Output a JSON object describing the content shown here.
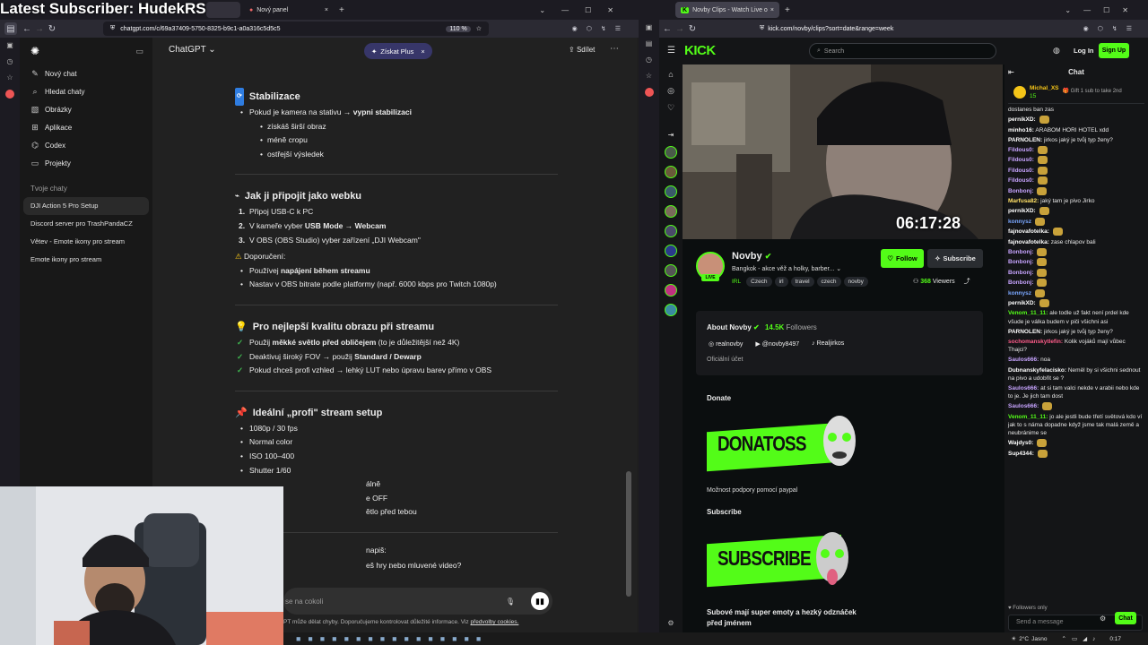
{
  "overlay_title": "Latest Subscriber: HudekRS",
  "left_browser": {
    "tabs": [
      {
        "label": "Nový panel"
      }
    ],
    "url": "chatgpt.com/c/69a37409-5750-8325-b9c1-a0a316c5d5c5",
    "zoom": "110 %"
  },
  "right_browser": {
    "tabs": [
      {
        "label": "Novby Clips - Watch Live o"
      }
    ],
    "url": "kick.com/novby/clips?sort=date&range=week"
  },
  "gpt": {
    "model": "ChatGPT",
    "upgrade": "Získat Plus",
    "share": "Sdílet",
    "sidebar": {
      "items": [
        {
          "label": "Nový chat",
          "icon": "edit-icon"
        },
        {
          "label": "Hledat chaty",
          "icon": "search-icon"
        },
        {
          "label": "Obrázky",
          "icon": "image-icon"
        },
        {
          "label": "Aplikace",
          "icon": "apps-icon"
        },
        {
          "label": "Codex",
          "icon": "code-icon"
        },
        {
          "label": "Projekty",
          "icon": "folder-icon"
        }
      ],
      "section": "Tvoje chaty",
      "chats": [
        "DJI Action 5 Pro Setup",
        "Discord server pro TrashPandaCZ",
        "Větev - Emote ikony pro stream",
        "Emote ikony pro stream"
      ]
    },
    "content": {
      "s1_title": "Stabilizace",
      "s1_b1_pre": "Pokud je kamera na stativu → ",
      "s1_b1_bold": "vypni stabilizaci",
      "s1_sub": [
        "získáš širší obraz",
        "méně cropu",
        "ostřejší výsledek"
      ],
      "s2_title": "Jak ji připojit jako webku",
      "s2_n1": "Připoj USB-C k PC",
      "s2_n2_pre": "V kameře vyber ",
      "s2_n2_bold": "USB Mode → Webcam",
      "s2_n3": "V OBS (OBS Studio) vyber zařízení „DJI Webcam\"",
      "s2_rec": "Doporučení:",
      "s2_r1_pre": "Používej ",
      "s2_r1_bold": "napájení během streamu",
      "s2_r2": "Nastav v OBS bitrate podle platformy (např. 6000 kbps pro Twitch 1080p)",
      "s3_title": "Pro nejlepší kvalitu obrazu při streamu",
      "s3_c1_pre": "Použij ",
      "s3_c1_bold": "měkké světlo před obličejem",
      "s3_c1_post": " (to je důležitější než 4K)",
      "s3_c2_pre": "Deaktivuj široký FOV → použij ",
      "s3_c2_bold": "Standard / Dewarp",
      "s3_c3": "Pokud chceš profi vzhled → lehký LUT nebo úpravu barev přímo v OBS",
      "s4_title": "Ideální „profi\" stream setup",
      "s4_items": [
        "1080p / 30 fps",
        "Normal color",
        "ISO 100–400",
        "Shutter 1/60",
        "álně",
        "e OFF",
        "ětlo před tebou"
      ],
      "s5_a": "napiš:",
      "s5_b": "eš hry nebo mluvené video?"
    },
    "composer_placeholder": "se na cokoli",
    "disclaimer": "PT může dělat chyby. Doporučujeme kontrolovat důležité informace. Viz",
    "disclaimer_link": "předvolby cookies."
  },
  "kick": {
    "search_placeholder": "Search",
    "login": "Log In",
    "signup": "Sign Up",
    "timestamp": "06:17:28",
    "channel": "Novby",
    "stream_title": "Bangkok - akce věž a holky, barber...",
    "category": "IRL",
    "tags": [
      "Czech",
      "irl",
      "travel",
      "czech",
      "novby"
    ],
    "follow": "Follow",
    "subscribe": "Subscribe",
    "viewers": "368",
    "viewers_label": "Viewers",
    "live": "LIVE",
    "about_title": "About Novby",
    "followers": "14.5K",
    "followers_label": "Followers",
    "socials": [
      "realnovby",
      "@novby8497",
      "Realjirkos"
    ],
    "official": "Oficiální účet",
    "donate_title": "Donate",
    "donate_banner": "DONATOSS",
    "donate_desc": "Možnost podpory pomocí paypal",
    "subscribe_title": "Subscribe",
    "subscribe_banner": "SUBSCRIBE",
    "subscribe_desc": "Subové mají super emoty a hezký odznáček před jménem",
    "chat": {
      "title": "Chat",
      "pinned_user": "Michal_XS",
      "pinned_count": "15",
      "pinned_text": "Gift 1 sub to take 2nd",
      "messages": [
        {
          "user": "",
          "text": "dostanes ban zas",
          "color": "#e8e8e8"
        },
        {
          "user": "pernikXD:",
          "text": "",
          "color": "#ffffff"
        },
        {
          "user": "minho16:",
          "text": "ARABOM HORI HOTEL xdd",
          "color": "#ffffff"
        },
        {
          "user": "PARNOLEN:",
          "text": "jirkos jaký je tvůj typ ženy?",
          "color": "#ffffff"
        },
        {
          "user": "Fildous0:",
          "text": "",
          "color": "#c7a4ff"
        },
        {
          "user": "Fildous0:",
          "text": "",
          "color": "#c7a4ff"
        },
        {
          "user": "Fildous0:",
          "text": "",
          "color": "#c7a4ff"
        },
        {
          "user": "Fildous0:",
          "text": "",
          "color": "#c7a4ff"
        },
        {
          "user": "Bonbonj:",
          "text": "",
          "color": "#c7a4ff"
        },
        {
          "user": "Marfusa82:",
          "text": "jaký tam je pivo Jirko",
          "color": "#ffe066"
        },
        {
          "user": "pernikXD:",
          "text": "",
          "color": "#ffffff"
        },
        {
          "user": "konnysz",
          "text": "",
          "color": "#7aa7ff"
        },
        {
          "user": "fajnovafotelka:",
          "text": "",
          "color": "#ffffff"
        },
        {
          "user": "fajnovafotelka:",
          "text": "zase chlapov bali",
          "color": "#ffffff"
        },
        {
          "user": "Bonbonj:",
          "text": "",
          "color": "#c7a4ff"
        },
        {
          "user": "Bonbonj:",
          "text": "",
          "color": "#c7a4ff"
        },
        {
          "user": "Bonbonj:",
          "text": "",
          "color": "#c7a4ff"
        },
        {
          "user": "Bonbonj:",
          "text": "",
          "color": "#c7a4ff"
        },
        {
          "user": "konnysz",
          "text": "",
          "color": "#7aa7ff"
        },
        {
          "user": "pernikXD:",
          "text": "",
          "color": "#ffffff"
        },
        {
          "user": "Venom_11_11:",
          "text": "ale todle už fakt není prdel kde všude je válka budem v piči všichni asi",
          "color": "#53fc18"
        },
        {
          "user": "PARNOLEN:",
          "text": "jirkos jaký je tvůj typ ženy?",
          "color": "#ffffff"
        },
        {
          "user": "sochomanskytlefin:",
          "text": "Kolik vojáků mají vůbec Thajci?",
          "color": "#ff5c8a"
        },
        {
          "user": "Saulos666:",
          "text": "noa",
          "color": "#c7a4ff"
        },
        {
          "user": "Dubnanskyfelacisko:",
          "text": "Neměl by si všichni sednout na pivo a udobřit se ?",
          "color": "#ffffff"
        },
        {
          "user": "Saulos666:",
          "text": "at si tam valci nekde v arabii nebo kde to je. Je jich tam dost",
          "color": "#c7a4ff"
        },
        {
          "user": "Saulos666:",
          "text": "",
          "color": "#c7a4ff"
        },
        {
          "user": "Venom_11_11:",
          "text": "jo ale jestli bude třetí světová kdo ví jak to s náma dopadne když jsme tak malá země a neubránime se",
          "color": "#53fc18"
        },
        {
          "user": "Wajdys0:",
          "text": "",
          "color": "#ffffff"
        },
        {
          "user": "Sup4344:",
          "text": "",
          "color": "#ffffff"
        }
      ],
      "followers_only": "Followers only",
      "input_placeholder": "Send a message",
      "send": "Chat"
    }
  },
  "taskbar": {
    "temp": "2°C",
    "weather": "Jasno",
    "time": "0:17"
  }
}
